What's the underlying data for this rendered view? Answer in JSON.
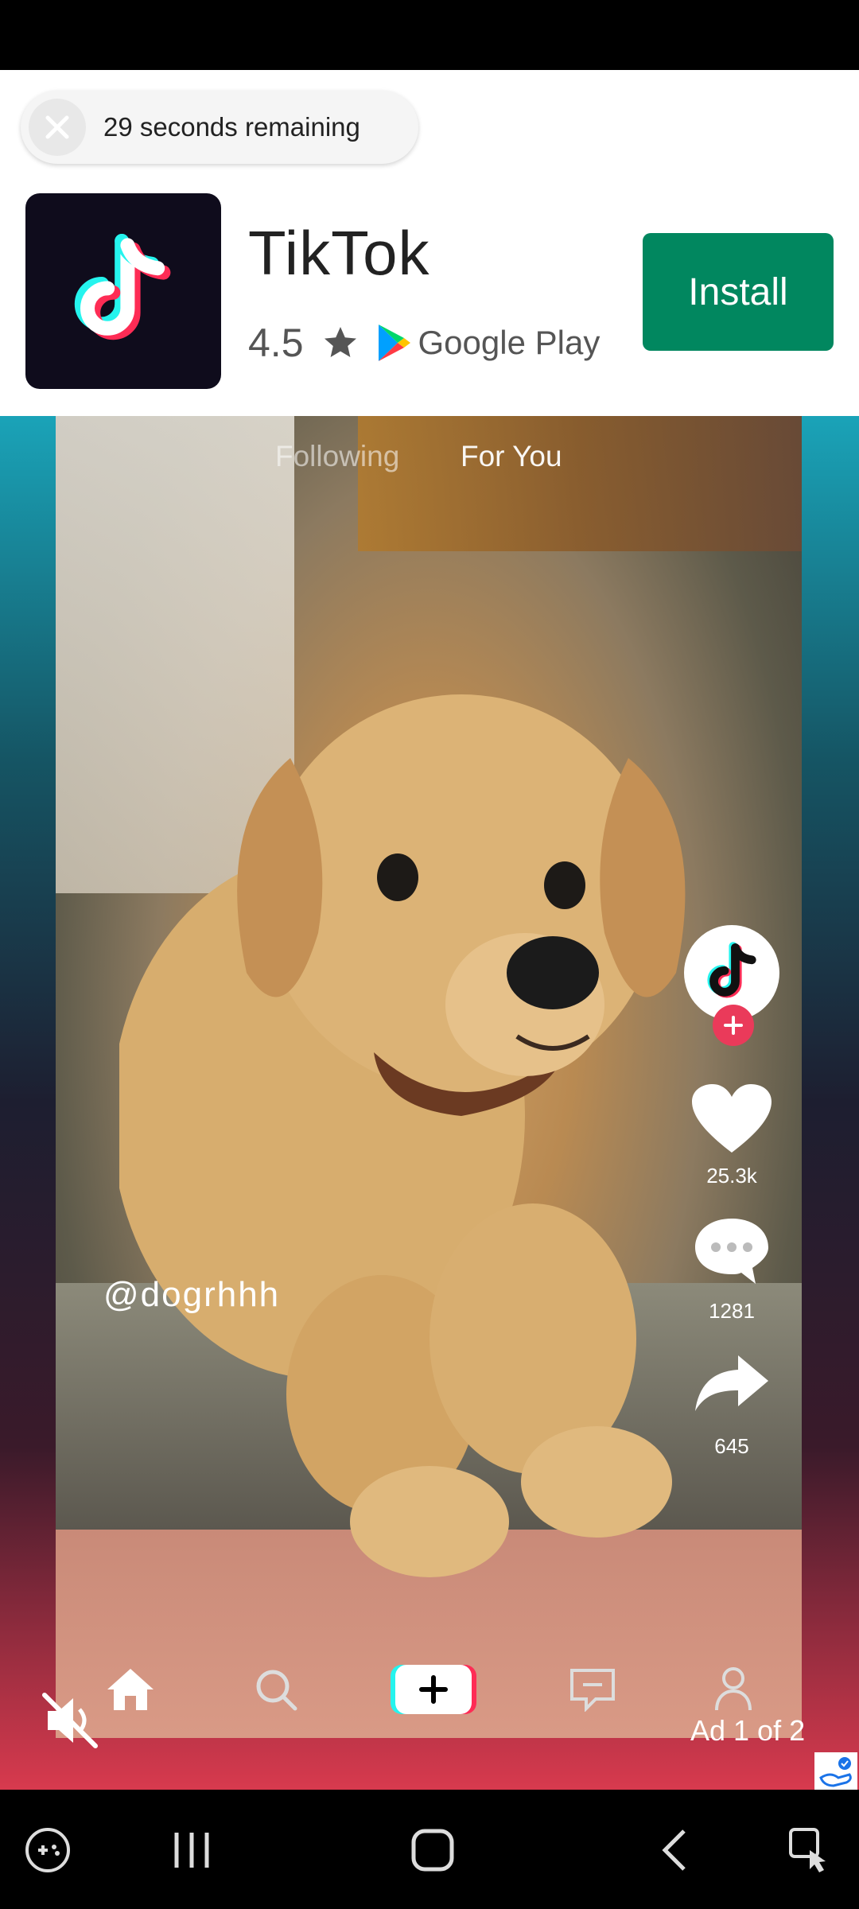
{
  "ad": {
    "timer_text": "29 seconds remaining",
    "app_name": "TikTok",
    "rating": "4.5",
    "store_name": "Google Play",
    "install_label": "Install",
    "counter_text": "Ad 1 of 2",
    "progress_fraction": 0.04
  },
  "video": {
    "tabs": [
      "Following",
      "For You"
    ],
    "active_tab": "For You",
    "username": "@dogrhhh",
    "likes": "25.3k",
    "comments": "1281",
    "shares": "645",
    "muted": true
  },
  "tiktok_nav": {
    "items": [
      "home-icon",
      "search-icon",
      "create-button",
      "inbox-icon",
      "profile-icon"
    ]
  },
  "system_nav": {
    "items": [
      "game-launcher-icon",
      "recents-icon",
      "home-icon",
      "back-icon",
      "accessibility-icon"
    ]
  },
  "colors": {
    "install_green": "#01875f",
    "progress": "#f0a020",
    "follow_red": "#ea3a5a"
  }
}
